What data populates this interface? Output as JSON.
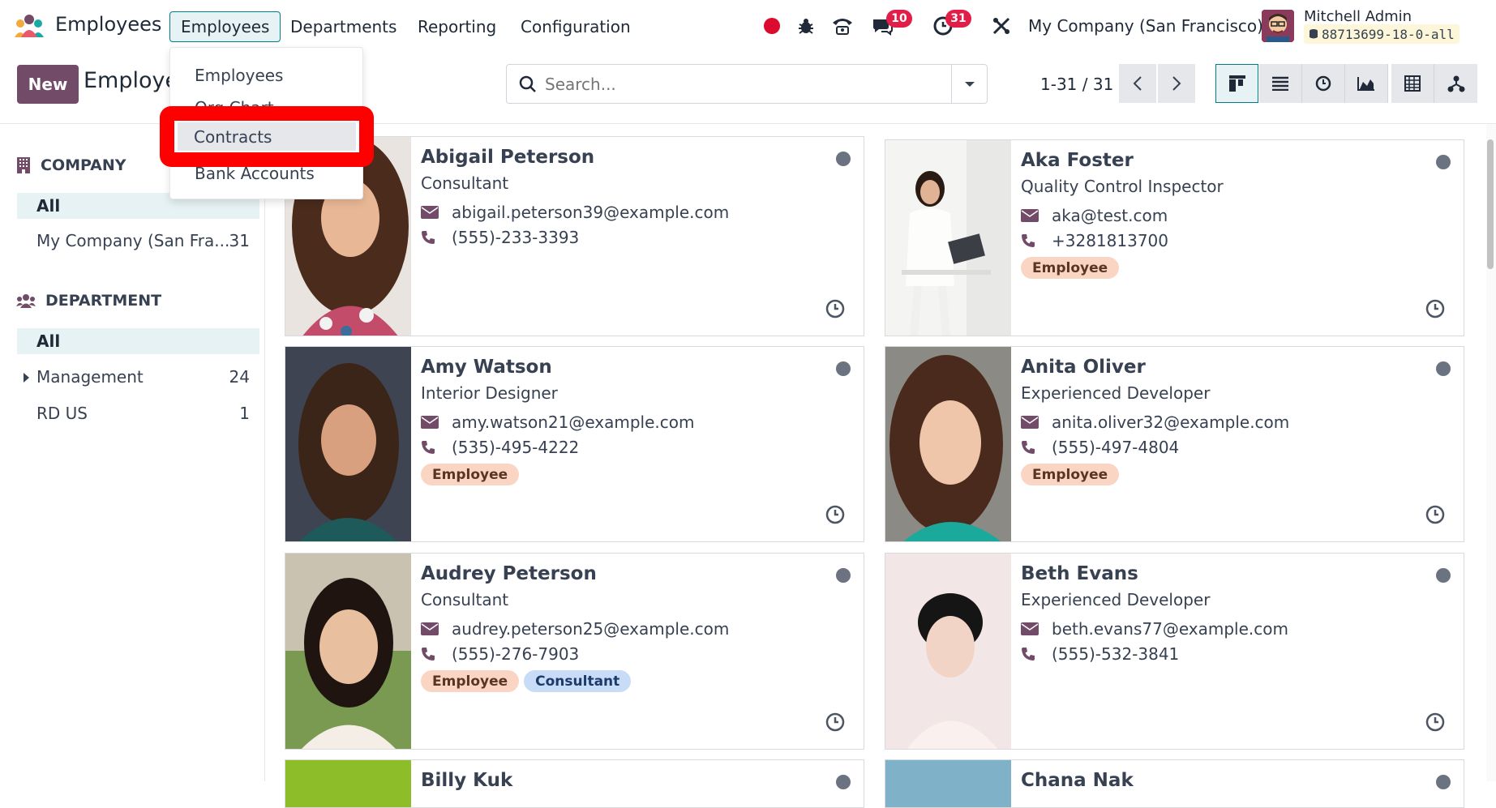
{
  "app": {
    "name": "Employees"
  },
  "nav": {
    "menus": [
      "Employees",
      "Departments",
      "Reporting",
      "Configuration"
    ],
    "badges": {
      "messages": "10",
      "activities": "31"
    },
    "company": "My Company (San Francisco)",
    "user": "Mitchell Admin",
    "database": "88713699-18-0-all"
  },
  "dropdown": {
    "items": [
      "Employees",
      "Org Chart",
      "Contracts",
      "Bank Accounts"
    ]
  },
  "control": {
    "new_label": "New",
    "breadcrumb": "Employees",
    "search_placeholder": "Search...",
    "pager": "1-31 / 31"
  },
  "sidebar": {
    "company": {
      "heading": "COMPANY",
      "items": [
        {
          "label": "All"
        },
        {
          "label": "My Company (San Fra...",
          "count": "31"
        }
      ]
    },
    "department": {
      "heading": "DEPARTMENT",
      "items": [
        {
          "label": "All"
        },
        {
          "label": "Management",
          "count": "24"
        },
        {
          "label": "RD US",
          "count": "1"
        }
      ]
    }
  },
  "employees": [
    {
      "name": "Abigail Peterson",
      "job": "Consultant",
      "email": "abigail.peterson39@example.com",
      "phone": "(555)-233-3393",
      "tags": []
    },
    {
      "name": "Aka Foster",
      "job": "Quality Control Inspector",
      "email": "aka@test.com",
      "phone": "+3281813700",
      "tags": [
        "Employee"
      ]
    },
    {
      "name": "Amy Watson",
      "job": "Interior Designer",
      "email": "amy.watson21@example.com",
      "phone": "(535)-495-4222",
      "tags": [
        "Employee"
      ]
    },
    {
      "name": "Anita Oliver",
      "job": "Experienced Developer",
      "email": "anita.oliver32@example.com",
      "phone": "(555)-497-4804",
      "tags": [
        "Employee"
      ]
    },
    {
      "name": "Audrey Peterson",
      "job": "Consultant",
      "email": "audrey.peterson25@example.com",
      "phone": "(555)-276-7903",
      "tags": [
        "Employee",
        "Consultant"
      ]
    },
    {
      "name": "Beth Evans",
      "job": "Experienced Developer",
      "email": "beth.evans77@example.com",
      "phone": "(555)-532-3841",
      "tags": []
    },
    {
      "name": "Billy Kuk",
      "job": "",
      "email": "",
      "phone": "",
      "tags": []
    },
    {
      "name": "Chana Nak",
      "job": "",
      "email": "",
      "phone": "",
      "tags": []
    }
  ],
  "colors": {
    "primary": "#714b67",
    "accent": "#017e84",
    "tag_employee": "#fbd5c4",
    "tag_consultant": "#c8dcf8",
    "highlight": "#ff0000"
  }
}
